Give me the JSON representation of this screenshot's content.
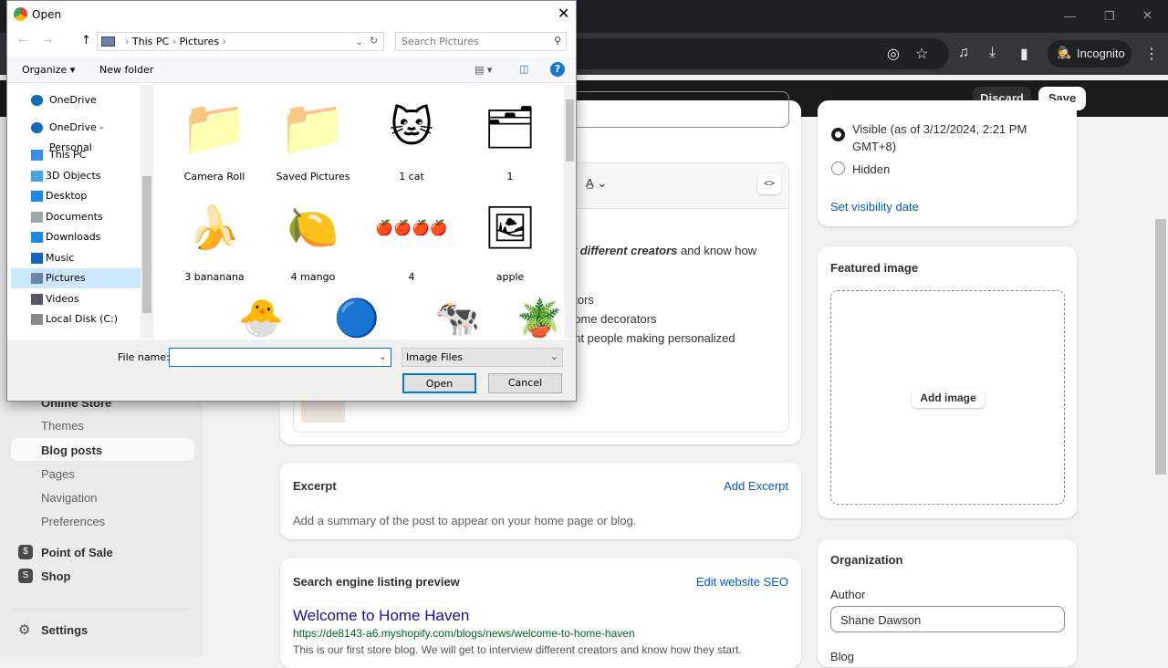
{
  "browser": {
    "incognito_label": "Incognito"
  },
  "topbar": {
    "discard": "Discard",
    "save": "Save"
  },
  "sidebar": {
    "online_store": "Online Store",
    "items": [
      {
        "label": "Themes"
      },
      {
        "label": "Blog posts"
      },
      {
        "label": "Pages"
      },
      {
        "label": "Navigation"
      },
      {
        "label": "Preferences"
      }
    ],
    "point_of_sale": "Point of Sale",
    "shop": "Shop",
    "settings": "Settings"
  },
  "editor": {
    "content_line1_bold": "w different creators",
    "content_line1_rest": " and know how",
    "line2": "ators",
    "line3": "home decorators",
    "line4": "ent people making personalized"
  },
  "visibility": {
    "visible": "Visible (as of 3/12/2024, 2:21 PM GMT+8)",
    "hidden": "Hidden",
    "selected": "visible",
    "set_date": "Set visibility date"
  },
  "featured": {
    "title": "Featured image",
    "add": "Add image"
  },
  "excerpt": {
    "title": "Excerpt",
    "add": "Add Excerpt",
    "hint": "Add a summary of the post to appear on your home page or blog."
  },
  "seo": {
    "title": "Search engine listing preview",
    "edit": "Edit website SEO",
    "page_title": "Welcome to Home Haven",
    "url": "https://de8143-a6.myshopify.com/blogs/news/welcome-to-home-haven",
    "description": "This is our first store blog. We will get to interview different creators and know how they start."
  },
  "organization": {
    "title": "Organization",
    "author_label": "Author",
    "author": "Shane Dawson",
    "blog_label": "Blog"
  },
  "dialog": {
    "title": "Open",
    "breadcrumb": [
      "This PC",
      "Pictures"
    ],
    "search_placeholder": "Search Pictures",
    "organize": "Organize",
    "new_folder": "New folder",
    "nav": [
      {
        "label": "OneDrive",
        "icon": "cloud-icon"
      },
      {
        "label": "OneDrive - Personal",
        "icon": "cloud-icon"
      },
      {
        "label": "This PC",
        "icon": "computer-icon"
      },
      {
        "label": "3D Objects",
        "icon": "cube-icon"
      },
      {
        "label": "Desktop",
        "icon": "desktop-icon"
      },
      {
        "label": "Documents",
        "icon": "document-icon"
      },
      {
        "label": "Downloads",
        "icon": "download-icon"
      },
      {
        "label": "Music",
        "icon": "music-icon"
      },
      {
        "label": "Pictures",
        "icon": "pictures-icon"
      },
      {
        "label": "Videos",
        "icon": "video-icon"
      },
      {
        "label": "Local Disk (C:)",
        "icon": "disk-icon"
      }
    ],
    "selected_nav": "Pictures",
    "files": [
      {
        "name": "Camera Roll",
        "icon": "📁"
      },
      {
        "name": "Saved Pictures",
        "icon": "📁"
      },
      {
        "name": "1 cat",
        "icon": "🐱"
      },
      {
        "name": "1",
        "icon": "🗂"
      },
      {
        "name": "3 bananana",
        "icon": "🍌"
      },
      {
        "name": "4 mango",
        "icon": "🍋"
      },
      {
        "name": "4",
        "icon": "🍎🍎🍎🍎"
      },
      {
        "name": "apple",
        "icon": "🖼"
      }
    ],
    "file_name_label": "File name:",
    "file_name": "",
    "file_type": "Image Files",
    "open": "Open",
    "cancel": "Cancel"
  }
}
